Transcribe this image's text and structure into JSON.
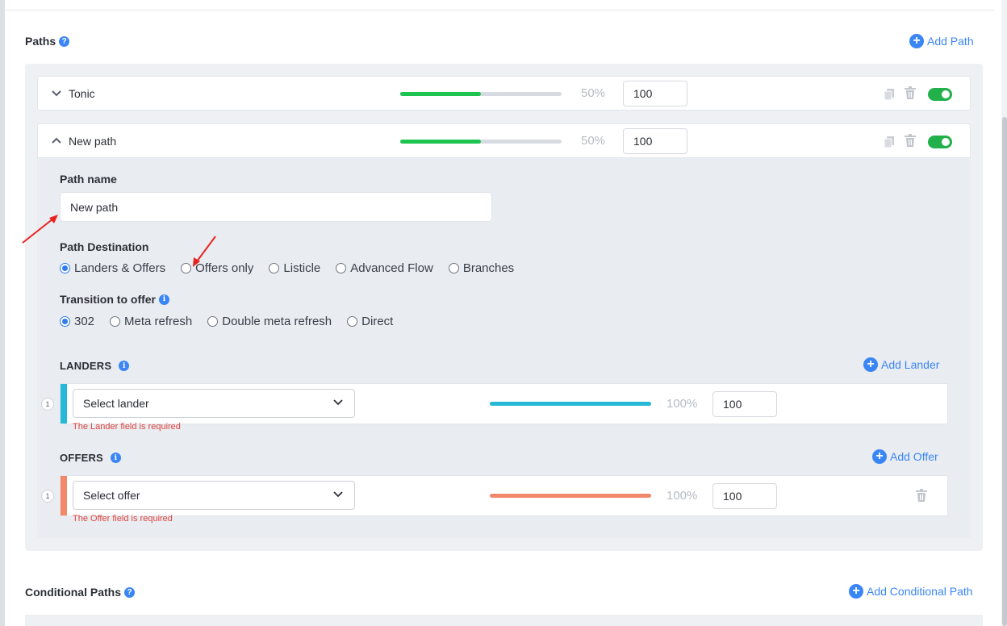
{
  "paths_section": {
    "title": "Paths",
    "help_icon": "help-circle-icon",
    "add_label": "Add Path"
  },
  "path_rows": [
    {
      "name": "Tonic",
      "percent_label": "50%",
      "weight": "100",
      "split": 0.5,
      "chevron": "chevron-down-icon",
      "enabled": true
    },
    {
      "name": "New path",
      "percent_label": "50%",
      "weight": "100",
      "split": 0.5,
      "chevron": "chevron-up-icon",
      "enabled": true
    }
  ],
  "path_form": {
    "name_label": "Path name",
    "name_value": "New path",
    "destination_label": "Path Destination",
    "destinations": [
      "Landers & Offers",
      "Offers only",
      "Listicle",
      "Advanced Flow",
      "Branches"
    ],
    "destination_selected": "Landers & Offers",
    "transition_label": "Transition to offer",
    "transitions": [
      "302",
      "Meta refresh",
      "Double meta refresh",
      "Direct"
    ],
    "transition_selected": "302"
  },
  "landers": {
    "title": "LANDERS",
    "add_label": "Add Lander",
    "index": "1",
    "select_placeholder": "Select lander",
    "percent_label": "100%",
    "weight": "100",
    "split": 1.0,
    "error": "The Lander field is required",
    "accent_color": "#25b9d7"
  },
  "offers": {
    "title": "OFFERS",
    "add_label": "Add Offer",
    "index": "1",
    "select_placeholder": "Select offer",
    "percent_label": "100%",
    "weight": "100",
    "split": 1.0,
    "error": "The Offer field is required",
    "accent_color": "#f3876a"
  },
  "conditional_section": {
    "title": "Conditional Paths",
    "add_label": "Add Conditional Path"
  },
  "colors": {
    "accent": "#3b86f6",
    "toggle_on": "#22b04b",
    "path_bar": "#1dc44f",
    "error": "#e0453f",
    "annotation_arrow": "#e8231f"
  }
}
